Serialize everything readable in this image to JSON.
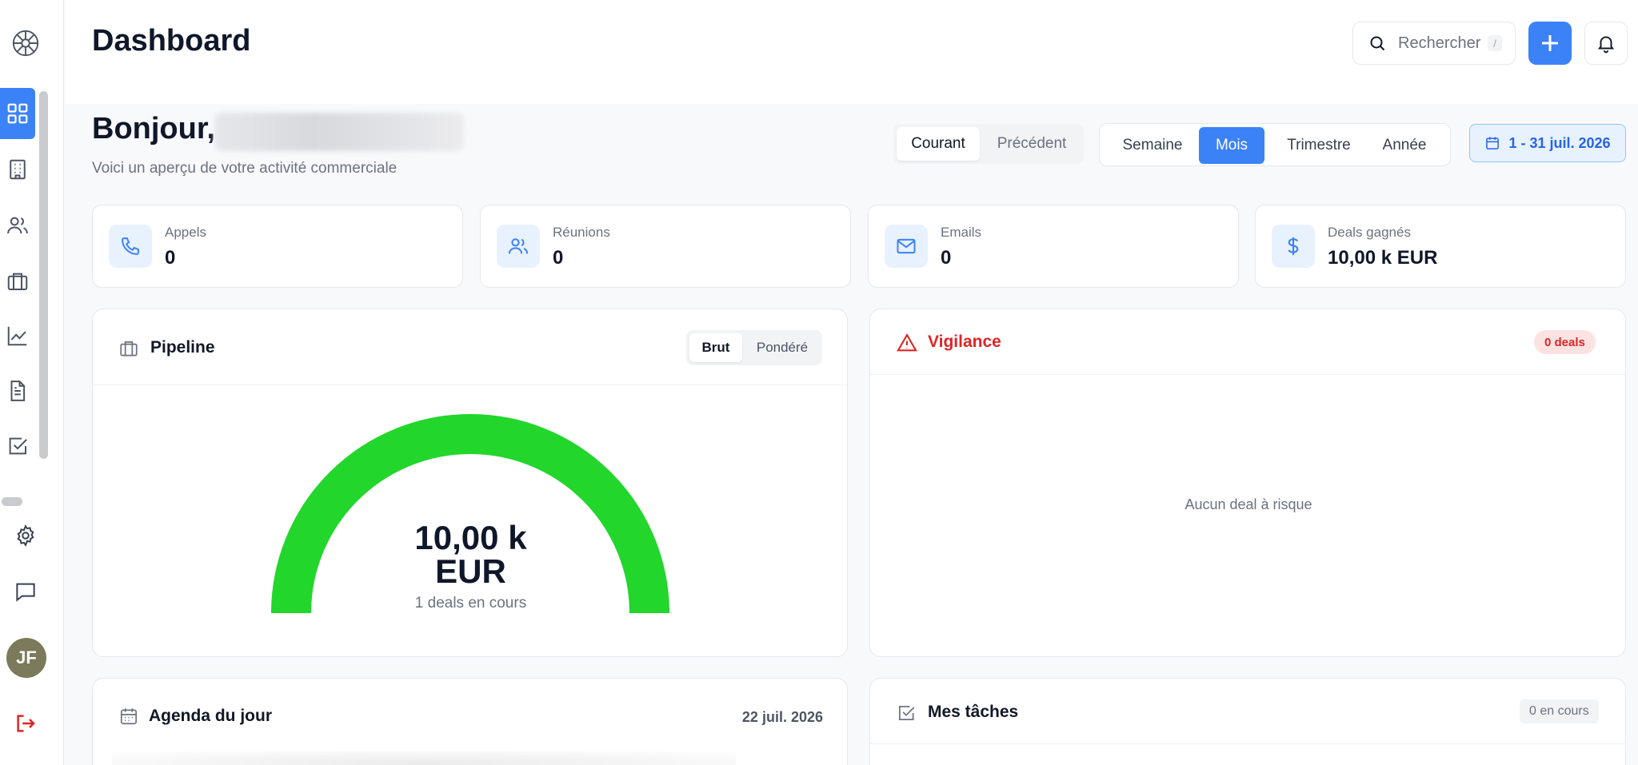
{
  "app": {
    "title": "Dashboard"
  },
  "header": {
    "search_placeholder": "Rechercher",
    "search_shortcut": "/"
  },
  "greeting": {
    "hello": "Bonjour,",
    "subtitle": "Voici un aperçu de votre activité commerciale"
  },
  "period_toggle": {
    "current": "Courant",
    "previous": "Précédent",
    "selected": "Courant"
  },
  "range_toggle": {
    "options": [
      "Semaine",
      "Mois",
      "Trimestre",
      "Année"
    ],
    "selected": "Mois"
  },
  "date_range": "1 - 31 juil. 2026",
  "stats": [
    {
      "label": "Appels",
      "value": "0",
      "icon": "phone-icon"
    },
    {
      "label": "Réunions",
      "value": "0",
      "icon": "users-icon"
    },
    {
      "label": "Emails",
      "value": "0",
      "icon": "mail-icon"
    },
    {
      "label": "Deals gagnés",
      "value": "10,00 k EUR",
      "icon": "dollar-icon"
    }
  ],
  "pipeline": {
    "title": "Pipeline",
    "toggle": {
      "gross": "Brut",
      "weighted": "Pondéré",
      "selected": "Brut"
    },
    "value_line1": "10,00 k",
    "value_line2": "EUR",
    "sub": "1 deals en cours",
    "gauge_fraction": 1.0,
    "gauge_color": "#22d62c"
  },
  "vigilance": {
    "title": "Vigilance",
    "badge": "0 deals",
    "empty": "Aucun deal à risque"
  },
  "agenda": {
    "title": "Agenda du jour",
    "date": "22 juil. 2026"
  },
  "tasks": {
    "title": "Mes tâches",
    "badge": "0 en cours"
  },
  "user": {
    "initials": "JF"
  },
  "colors": {
    "accent": "#3b82f6",
    "danger": "#dc2626",
    "gauge": "#22d62c"
  }
}
